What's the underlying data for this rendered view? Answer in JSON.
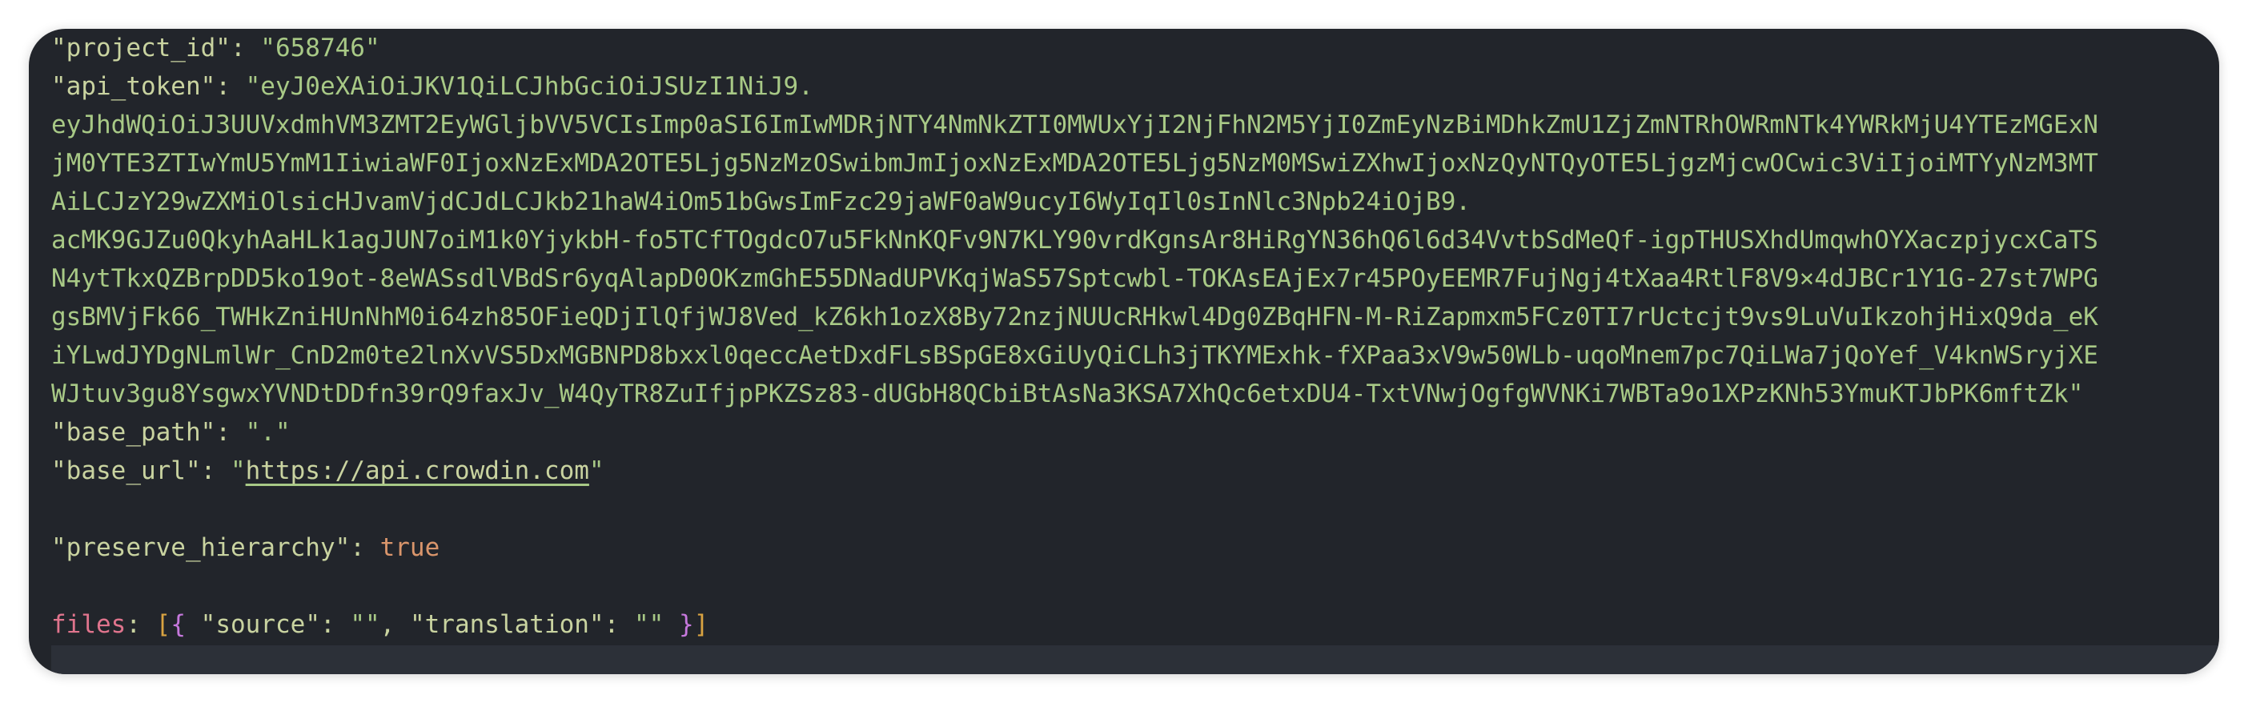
{
  "config": {
    "project_id_key": "\"project_id\"",
    "project_id_value": "\"658746\"",
    "api_token_key": "\"api_token\"",
    "api_token_lines": [
      "\"eyJ0eXAiOiJKV1QiLCJhbGciOiJSUzI1NiJ9.",
      "eyJhdWQiOiJ3UUVxdmhVM3ZMT2EyWGljbVV5VCIsImp0aSI6ImIwMDRjNTY4NmNkZTI0MWUxYjI2NjFhN2M5YjI0ZmEyNzBiMDhkZmU1ZjZmNTRhOWRmNTk4YWRkMjU4YTEzMGExN",
      "jM0YTE3ZTIwYmU5YmM1IiwiaWF0IjoxNzExMDA2OTE5Ljg5NzMzOSwibmJmIjoxNzExMDA2OTE5Ljg5NzM0MSwiZXhwIjoxNzQyNTQyOTE5LjgzMjcwOCwic3ViIjoiMTYyNzM3MT",
      "AiLCJzY29wZXMiOlsicHJvamVjdCJdLCJkb21haW4iOm51bGwsImFzc29jaWF0aW9ucyI6WyIqIl0sInNlc3Npb24iOjB9.",
      "acMK9GJZu0QkyhAaHLk1agJUN7oiM1k0YjykbH-fo5TCfTOgdcO7u5FkNnKQFv9N7KLY90vrdKgnsAr8HiRgYN36hQ6l6d34VvtbSdMeQf-igpTHUSXhdUmqwhOYXaczpjycxCaTS",
      "N4ytTkxQZBrpDD5ko19ot-8eWASsdlVBdSr6yqAlapD0OKzmGhE55DNadUPVKqjWaS57Sptcwbl-TOKAsEAjEx7r45POyEEMR7FujNgj4tXaa4RtlF8V9×4dJBCr1Y1G-27st7WPG",
      "gsBMVjFk66_TWHkZniHUnNhM0i64zh85OFieQDjIlQfjWJ8Ved_kZ6kh1ozX8By72nzjNUUcRHkwl4Dg0ZBqHFN-M-RiZapmxm5FCz0TI7rUctcjt9vs9LuVuIkzohjHixQ9da_eK",
      "iYLwdJYDgNLmlWr_CnD2m0te2lnXvVS5DxMGBNPD8bxxl0qeccAetDxdFLsBSpGE8xGiUyQiCLh3jTKYMExhk-fXPaa3xV9w50WLb-uqoMnem7pc7QiLWa7jQoYef_V4knWSryjXE",
      "WJtuv3gu8YsgwxYVNDtDDfn39rQ9faxJv_W4QyTR8ZuIfjpPKZSz83-dUGbH8QCbiBtAsNa3KSA7XhQc6etxDU4-TxtVNwjOgfgWVNKi7WBTa9o1XPzKNh53YmuKTJbPK6mftZk\""
    ],
    "base_path_key": "\"base_path\"",
    "base_path_value": "\".\"",
    "base_url_key": "\"base_url\"",
    "base_url_value": "https://api.crowdin.com",
    "preserve_hierarchy_key": "\"preserve_hierarchy\"",
    "preserve_hierarchy_value": "true",
    "files_key": "files",
    "files_source_key": "\"source\"",
    "files_source_value": "\"\"",
    "files_translation_key": "\"translation\"",
    "files_translation_value": "\"\""
  },
  "colors": {
    "background": "#22252b",
    "key": "#c9d3a0",
    "string": "#a8c986",
    "boolean": "#d9956b",
    "files_key": "#e0748d",
    "bracket": "#d9a341",
    "brace": "#c678dd"
  }
}
